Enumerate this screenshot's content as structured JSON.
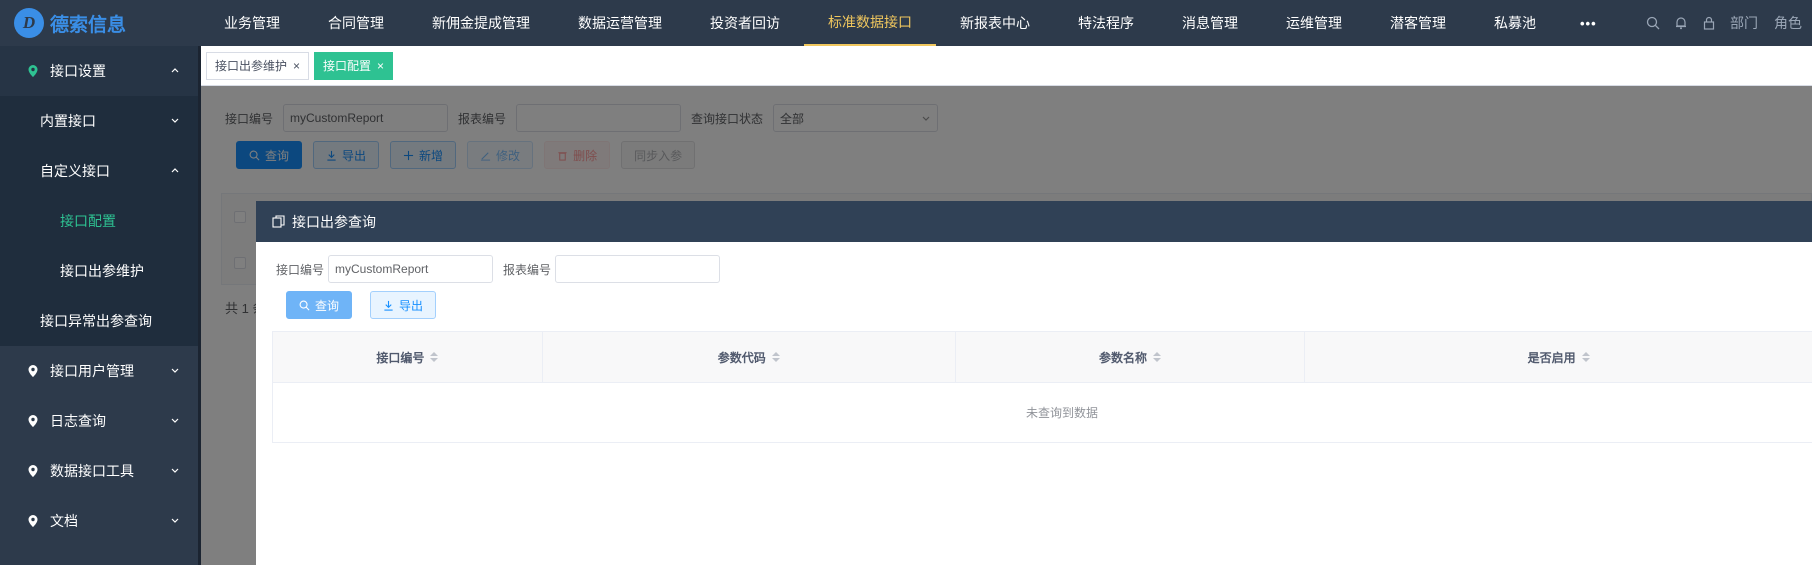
{
  "brand": {
    "logo_letter": "D",
    "name": "德索信息"
  },
  "topnav": {
    "items": [
      "业务管理",
      "合同管理",
      "新佣金提成管理",
      "数据运营管理",
      "投资者回访",
      "标准数据接口",
      "新报表中心",
      "特法程序",
      "消息管理",
      "运维管理",
      "潜客管理",
      "私募池"
    ],
    "active_index": 5,
    "more": "•••",
    "right": {
      "dept": "部门",
      "role": "角色"
    },
    "icons": [
      "search-icon",
      "bell-icon",
      "lock-icon"
    ]
  },
  "sidebar": {
    "group": "接口设置",
    "builtin": "内置接口",
    "custom": "自定义接口",
    "custom_config": "接口配置",
    "custom_output": "接口出参维护",
    "exception": "接口异常出参查询",
    "user_mgmt": "接口用户管理",
    "log": "日志查询",
    "tools": "数据接口工具",
    "docs": "文档"
  },
  "tabs": [
    {
      "label": "接口出参维护",
      "active": false,
      "close": "×"
    },
    {
      "label": "接口配置",
      "active": true,
      "close": "×"
    }
  ],
  "filter": {
    "interface_code_label": "接口编号",
    "interface_code_value": "myCustomReport",
    "report_code_label": "报表编号",
    "report_code_value": "",
    "status_label": "查询接口状态",
    "status_value": "全部"
  },
  "toolbar": {
    "query": "查询",
    "export": "导出",
    "add": "新增",
    "edit": "修改",
    "delete": "删除",
    "sync": "同步入参"
  },
  "total_text": "共 1 条",
  "dialog": {
    "title": "接口出参查询",
    "interface_code_label": "接口编号",
    "interface_code_value": "myCustomReport",
    "report_code_label": "报表编号",
    "report_code_value": "",
    "query": "查询",
    "export": "导出",
    "columns": [
      "接口编号",
      "参数代码",
      "参数名称",
      "是否启用"
    ],
    "empty_text": "未查询到数据"
  },
  "colors": {
    "sidebar_bg": "#2d3a4b",
    "active_nav": "#f0c75e",
    "accent_green": "#2ec292",
    "primary": "#1890ff"
  }
}
